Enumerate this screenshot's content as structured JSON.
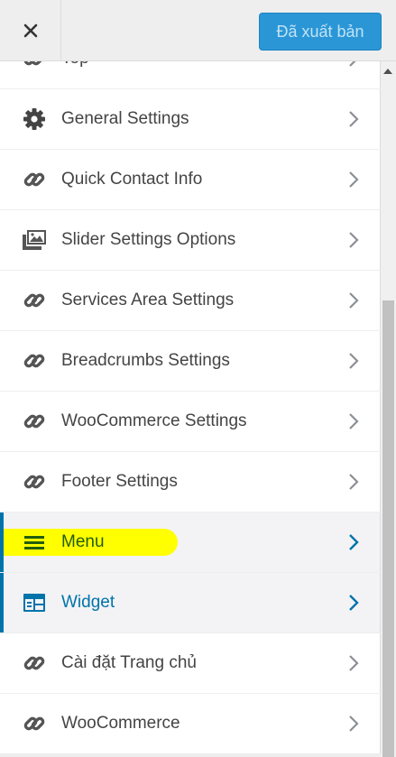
{
  "header": {
    "close_icon": "close-icon",
    "publish_label": "Đã xuất bản"
  },
  "menu": {
    "partial_item": {
      "label": "Top",
      "icon": "link-icon"
    },
    "items": [
      {
        "label": "General Settings",
        "icon": "gear-icon"
      },
      {
        "label": "Quick Contact Info",
        "icon": "link-icon"
      },
      {
        "label": "Slider Settings Options",
        "icon": "images-icon"
      },
      {
        "label": "Services Area Settings",
        "icon": "link-icon"
      },
      {
        "label": "Breadcrumbs Settings",
        "icon": "link-icon"
      },
      {
        "label": "WooCommerce Settings",
        "icon": "link-icon"
      },
      {
        "label": "Footer Settings",
        "icon": "link-icon"
      },
      {
        "label": "Menu",
        "icon": "menu-icon"
      },
      {
        "label": "Widget",
        "icon": "widget-icon"
      },
      {
        "label": "Cài đặt Trang chủ",
        "icon": "link-icon"
      },
      {
        "label": "WooCommerce",
        "icon": "link-icon"
      }
    ]
  },
  "colors": {
    "accent": "#0073aa",
    "highlight": "#ffff00",
    "publish_bg": "#2b96d6",
    "menu_text": "#235d0e"
  }
}
